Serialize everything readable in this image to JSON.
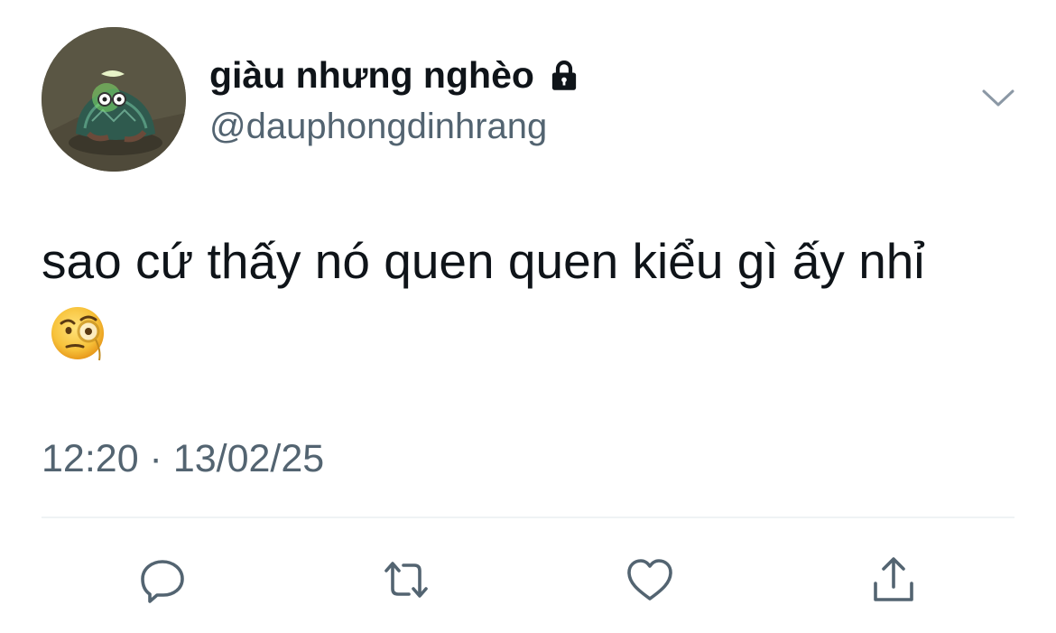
{
  "tweet": {
    "display_name": "giàu nhưng nghèo",
    "handle": "@dauphongdinhrang",
    "text": "sao cứ thấy nó quen quen kiểu gì ấy nhỉ",
    "emoji": "face-with-monocle",
    "timestamp": "12:20 · 13/02/25",
    "protected": true
  },
  "actions": [
    {
      "icon": "reply-icon"
    },
    {
      "icon": "retweet-icon"
    },
    {
      "icon": "like-icon"
    },
    {
      "icon": "share-icon"
    }
  ],
  "colors": {
    "text_primary": "#0f1419",
    "text_secondary": "#536471",
    "icon": "#536471",
    "divider": "#eff3f4"
  }
}
